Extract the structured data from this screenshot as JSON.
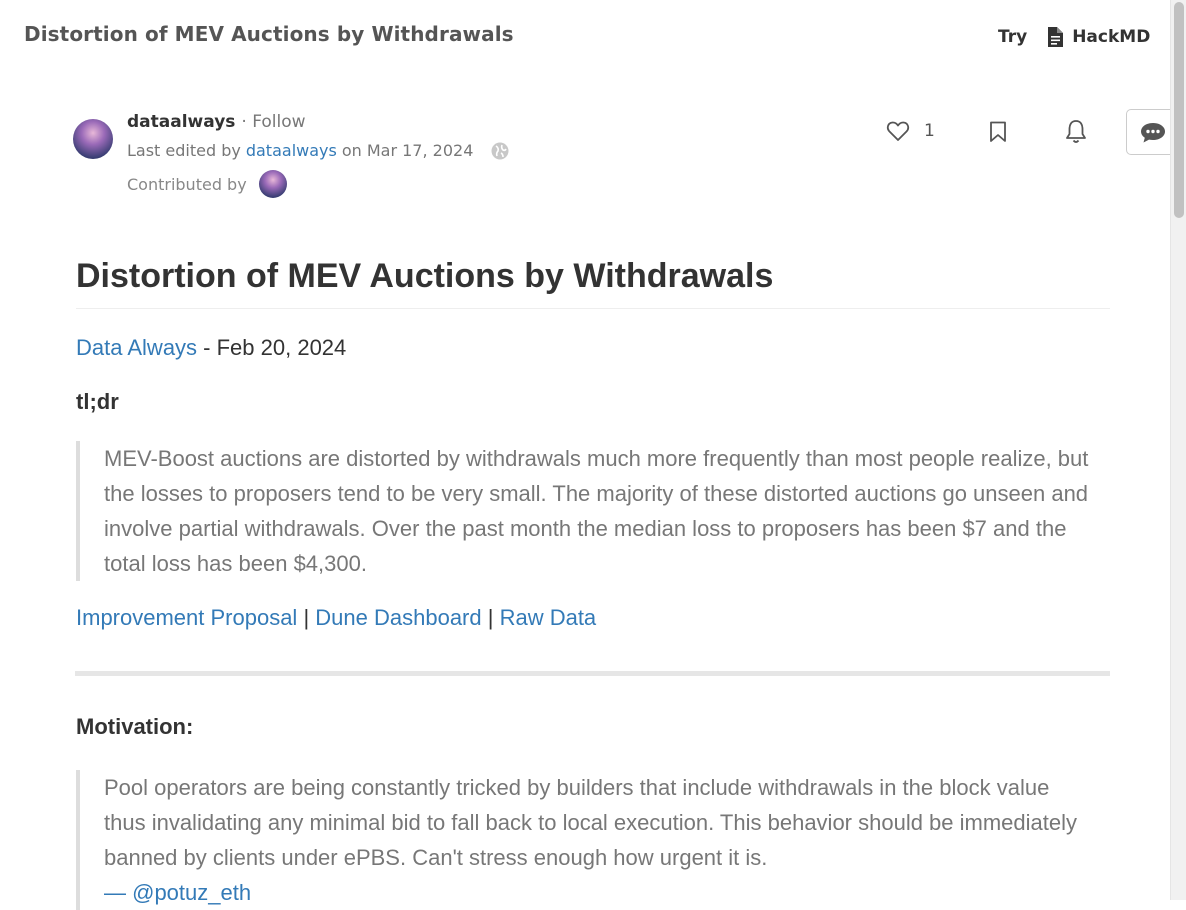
{
  "header": {
    "doc_title": "Distortion of MEV Auctions by Withdrawals",
    "try_label": "Try",
    "hackmd_label": "HackMD"
  },
  "author": {
    "name": "dataalways",
    "follow_label": "· Follow",
    "edited_prefix": "Last edited by",
    "edited_by": "dataalways",
    "edited_on": "on Mar 17, 2024",
    "contributed_label": "Contributed by"
  },
  "actions": {
    "like_count": "1"
  },
  "article": {
    "title": "Distortion of MEV Auctions by Withdrawals",
    "byline_author": "Data Always",
    "byline_date": " - Feb 20, 2024",
    "tldr_heading": "tl;dr",
    "tldr_text": "MEV-Boost auctions are distorted by withdrawals much more frequently than most people realize, but the losses to proposers tend to be very small. The majority of these distorted auctions go unseen and involve partial withdrawals. Over the past month the median loss to proposers has been $7 and the total loss has been $4,300.",
    "links": {
      "improvement": "Improvement Proposal",
      "sep": " | ",
      "dune": "Dune Dashboard",
      "raw": "Raw Data"
    },
    "motivation_heading": "Motivation:",
    "motivation_quote": "Pool operators are being constantly tricked by builders that include withdrawals in the block value thus invalidating any minimal bid to fall back to local execution. This behavior should be immediately banned by clients under ePBS. Can't stress enough how urgent it is.",
    "motivation_attrib": "— @potuz_eth"
  },
  "colors": {
    "link": "#337ab7",
    "text": "#333333",
    "muted": "#777777"
  },
  "icons": [
    "file-icon",
    "globe-icon",
    "heart-icon",
    "bookmark-icon",
    "bell-icon",
    "comment-icon"
  ]
}
